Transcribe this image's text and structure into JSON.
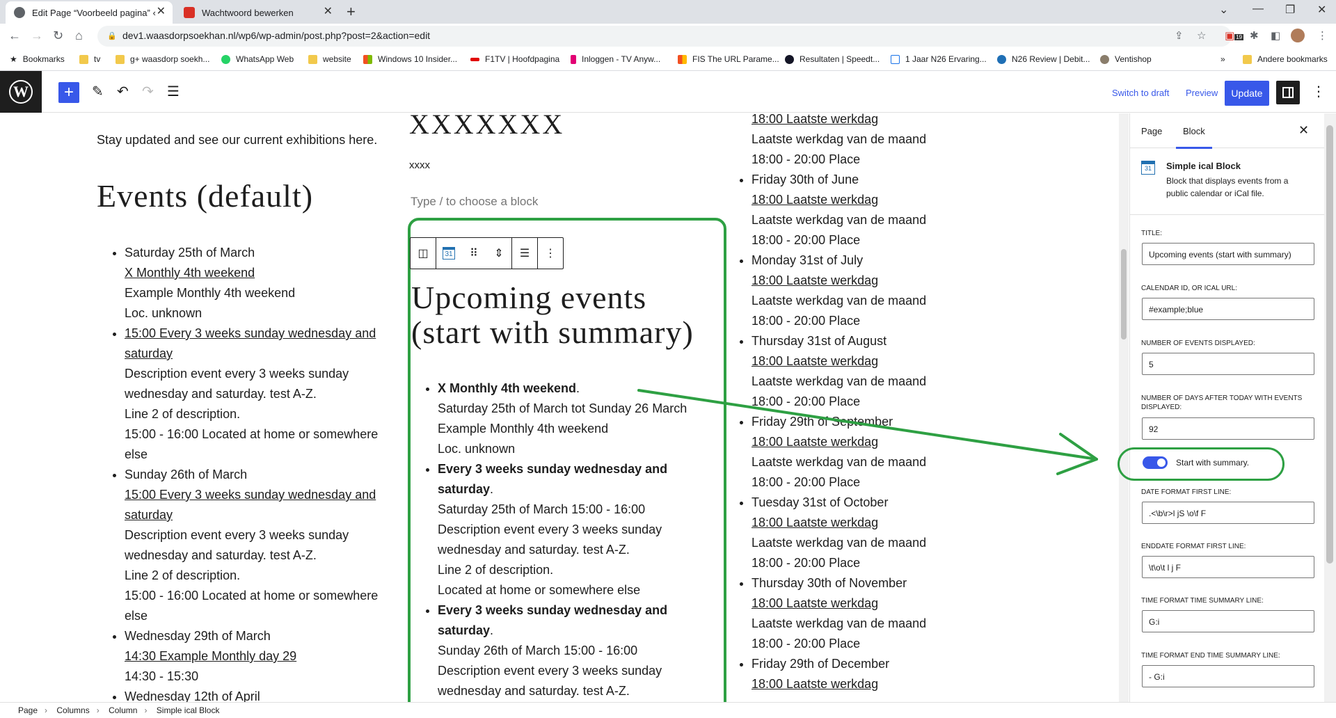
{
  "browser": {
    "tabs": [
      {
        "title": "Edit Page “Voorbeeld pagina” ‹ w"
      },
      {
        "title": "Wachtwoord bewerken"
      }
    ],
    "url": "dev1.waasdorpsoekhan.nl/wp6/wp-admin/post.php?post=2&action=edit",
    "bookmarks": [
      {
        "label": "Bookmarks"
      },
      {
        "label": "tv"
      },
      {
        "label": "g+ waasdorp soekh..."
      },
      {
        "label": "WhatsApp Web"
      },
      {
        "label": "website"
      },
      {
        "label": "Windows 10 Insider..."
      },
      {
        "label": "F1TV | Hoofdpagina"
      },
      {
        "label": "Inloggen - TV Anyw..."
      },
      {
        "label": "FIS The URL Parame..."
      },
      {
        "label": "Resultaten | Speedt..."
      },
      {
        "label": "1 Jaar N26 Ervaring..."
      },
      {
        "label": "N26 Review | Debit..."
      },
      {
        "label": "Ventishop"
      },
      {
        "label": "Andere bookmarks"
      }
    ],
    "extension_badge": "19"
  },
  "wp_toolbar": {
    "switch_to_draft": "Switch to draft",
    "preview": "Preview",
    "update": "Update"
  },
  "column1": {
    "intro": "Stay updated and see our current exhibitions here.",
    "heading": "Events (default)",
    "items": [
      {
        "lines": [
          "Saturday 25th of March",
          "X Monthly 4th weekend",
          "Example Monthly 4th weekend",
          "Loc. unknown"
        ]
      },
      {
        "lines": [
          "15:00 Every 3 weeks sunday wednesday and saturday",
          "Description event every 3 weeks sunday wednesday and saturday. test A-Z.",
          "Line 2 of description.",
          "15:00 - 16:00 Located at home or somewhere else"
        ]
      },
      {
        "lines": [
          "Sunday 26th of March",
          "15:00 Every 3 weeks sunday wednesday and saturday",
          "Description event every 3 weeks sunday wednesday and saturday. test A-Z.",
          "Line 2 of description.",
          "15:00 - 16:00 Located at home or somewhere else"
        ]
      },
      {
        "lines": [
          "Wednesday 29th of March",
          "14:30 Example Monthly day 29",
          "14:30 - 15:30"
        ]
      },
      {
        "lines": [
          "Wednesday 12th of April"
        ]
      }
    ]
  },
  "column2": {
    "title": "XXXXXXX",
    "text": "xxxx",
    "placeholder": "Type / to choose a block",
    "block_icon_text": "31",
    "heading": "Upcoming events (start with summary)",
    "items": [
      {
        "title": "X Monthly 4th weekend",
        "lines": [
          "Saturday 25th of March tot Sunday 26 March",
          "Example Monthly 4th weekend",
          "Loc. unknown"
        ]
      },
      {
        "title": "Every 3 weeks sunday wednesday and saturday",
        "lines": [
          "Saturday 25th of March 15:00 - 16:00",
          "Description event every 3 weeks sunday wednesday and saturday. test A-Z.",
          "Line 2 of description.",
          "Located at home or somewhere else"
        ]
      },
      {
        "title": "Every 3 weeks sunday wednesday and saturday",
        "lines": [
          "Sunday 26th of March 15:00 - 16:00",
          "Description event every 3 weeks sunday wednesday and saturday. test A-Z."
        ]
      }
    ]
  },
  "column3": {
    "top_lines": [
      "18:00 Laatste werkdag",
      "Laatste werkdag van de maand",
      "18:00 - 20:00 Place"
    ],
    "items": [
      {
        "date": "Friday 30th of June",
        "link": "18:00 Laatste werkdag",
        "desc": "Laatste werkdag van de maand",
        "time": "18:00 - 20:00 Place"
      },
      {
        "date": "Monday 31st of July",
        "link": "18:00 Laatste werkdag",
        "desc": "Laatste werkdag van de maand",
        "time": "18:00 - 20:00 Place"
      },
      {
        "date": "Thursday 31st of August",
        "link": "18:00 Laatste werkdag",
        "desc": "Laatste werkdag van de maand",
        "time": "18:00 - 20:00 Place"
      },
      {
        "date": "Friday 29th of September",
        "link": "18:00 Laatste werkdag",
        "desc": "Laatste werkdag van de maand",
        "time": "18:00 - 20:00 Place"
      },
      {
        "date": "Tuesday 31st of October",
        "link": "18:00 Laatste werkdag",
        "desc": "Laatste werkdag van de maand",
        "time": "18:00 - 20:00 Place"
      },
      {
        "date": "Thursday 30th of November",
        "link": "18:00 Laatste werkdag",
        "desc": "Laatste werkdag van de maand",
        "time": "18:00 - 20:00 Place"
      },
      {
        "date": "Friday 29th of December",
        "link": "18:00 Laatste werkdag",
        "desc": "",
        "time": ""
      }
    ]
  },
  "sidebar": {
    "tab_page": "Page",
    "tab_block": "Block",
    "block_name": "Simple ical Block",
    "block_icon_text": "31",
    "block_desc": "Block that displays events from a public calendar or iCal file.",
    "fields": [
      {
        "label": "TITLE:",
        "value": "Upcoming events (start with summary)"
      },
      {
        "label": "CALENDAR ID, OR ICAL URL:",
        "value": "#example;blue"
      },
      {
        "label": "NUMBER OF EVENTS DISPLAYED:",
        "value": "5"
      },
      {
        "label": "NUMBER OF DAYS AFTER TODAY WITH EVENTS DISPLAYED:",
        "value": "92"
      },
      {
        "label": "DATE FORMAT FIRST LINE:",
        "value": ".<\\b\\r>l jS \\o\\f  F"
      },
      {
        "label": "ENDDATE FORMAT FIRST LINE:",
        "value": " \\t\\o\\t  l j F"
      },
      {
        "label": "TIME FORMAT TIME SUMMARY LINE:",
        "value": "G:i"
      },
      {
        "label": "TIME FORMAT END TIME SUMMARY LINE:",
        "value": " - G:i"
      }
    ],
    "toggle_label": "Start with summary."
  },
  "breadcrumb": [
    "Page",
    "Columns",
    "Column",
    "Simple ical Block"
  ],
  "colors": {
    "wp_blue": "#3858e9",
    "annotation_green": "#2ea043",
    "wp_dark": "#1e1e1e"
  }
}
